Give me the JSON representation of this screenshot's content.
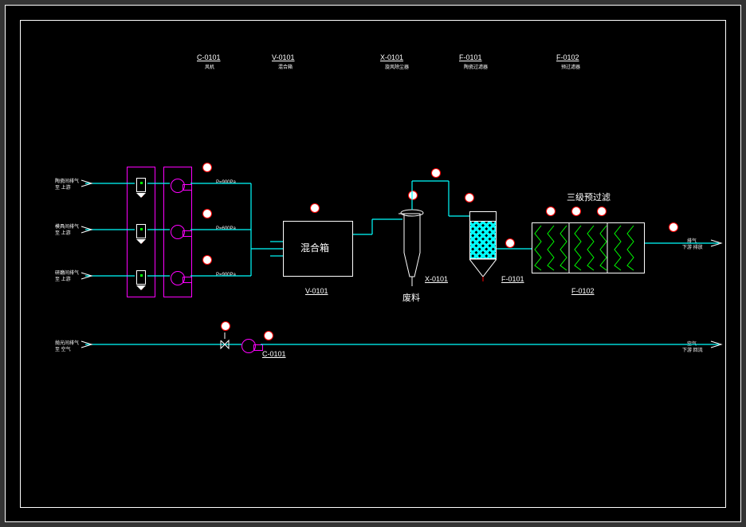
{
  "header": {
    "c0101": {
      "tag": "C-0101",
      "name": "风机"
    },
    "v0101": {
      "tag": "V-0101",
      "name": "混合箱"
    },
    "x0101": {
      "tag": "X-0101",
      "name": "旋风除尘器"
    },
    "f0101": {
      "tag": "F-0101",
      "name": "陶瓷过滤器"
    },
    "f0102": {
      "tag": "F-0102",
      "name": "预过滤器"
    }
  },
  "equipment": {
    "mixbox": {
      "label": "混合箱",
      "tag": "V-0101"
    },
    "cyclone": {
      "tag": "X-0101",
      "bottom": "废料"
    },
    "ceramic": {
      "tag": "F-0101"
    },
    "prefilter": {
      "title": "三级预过滤",
      "tag": "F-0102"
    },
    "fan": {
      "tag": "C-0101"
    }
  },
  "inlets": {
    "in1": {
      "label": "陶瓷间排气",
      "sub": "至 上游"
    },
    "in2": {
      "label": "模具间排气",
      "sub": "至 上游"
    },
    "in3": {
      "label": "研磨间排气",
      "sub": "至 上游"
    },
    "in4": {
      "label": "抛光间排气",
      "sub": "至 空气"
    }
  },
  "outlets": {
    "out1": {
      "label": "排气",
      "sub": "下游   排放"
    },
    "out2": {
      "label": "空气",
      "sub": "下游   回流"
    }
  },
  "flow_tags": {
    "p1": "P=900Pa",
    "p2": "P=600Pa",
    "p3": "P=900Pa"
  },
  "colors": {
    "process_line": "#00ffff",
    "equipment_group": "#ff00ff",
    "instrument": "#ff0000"
  }
}
